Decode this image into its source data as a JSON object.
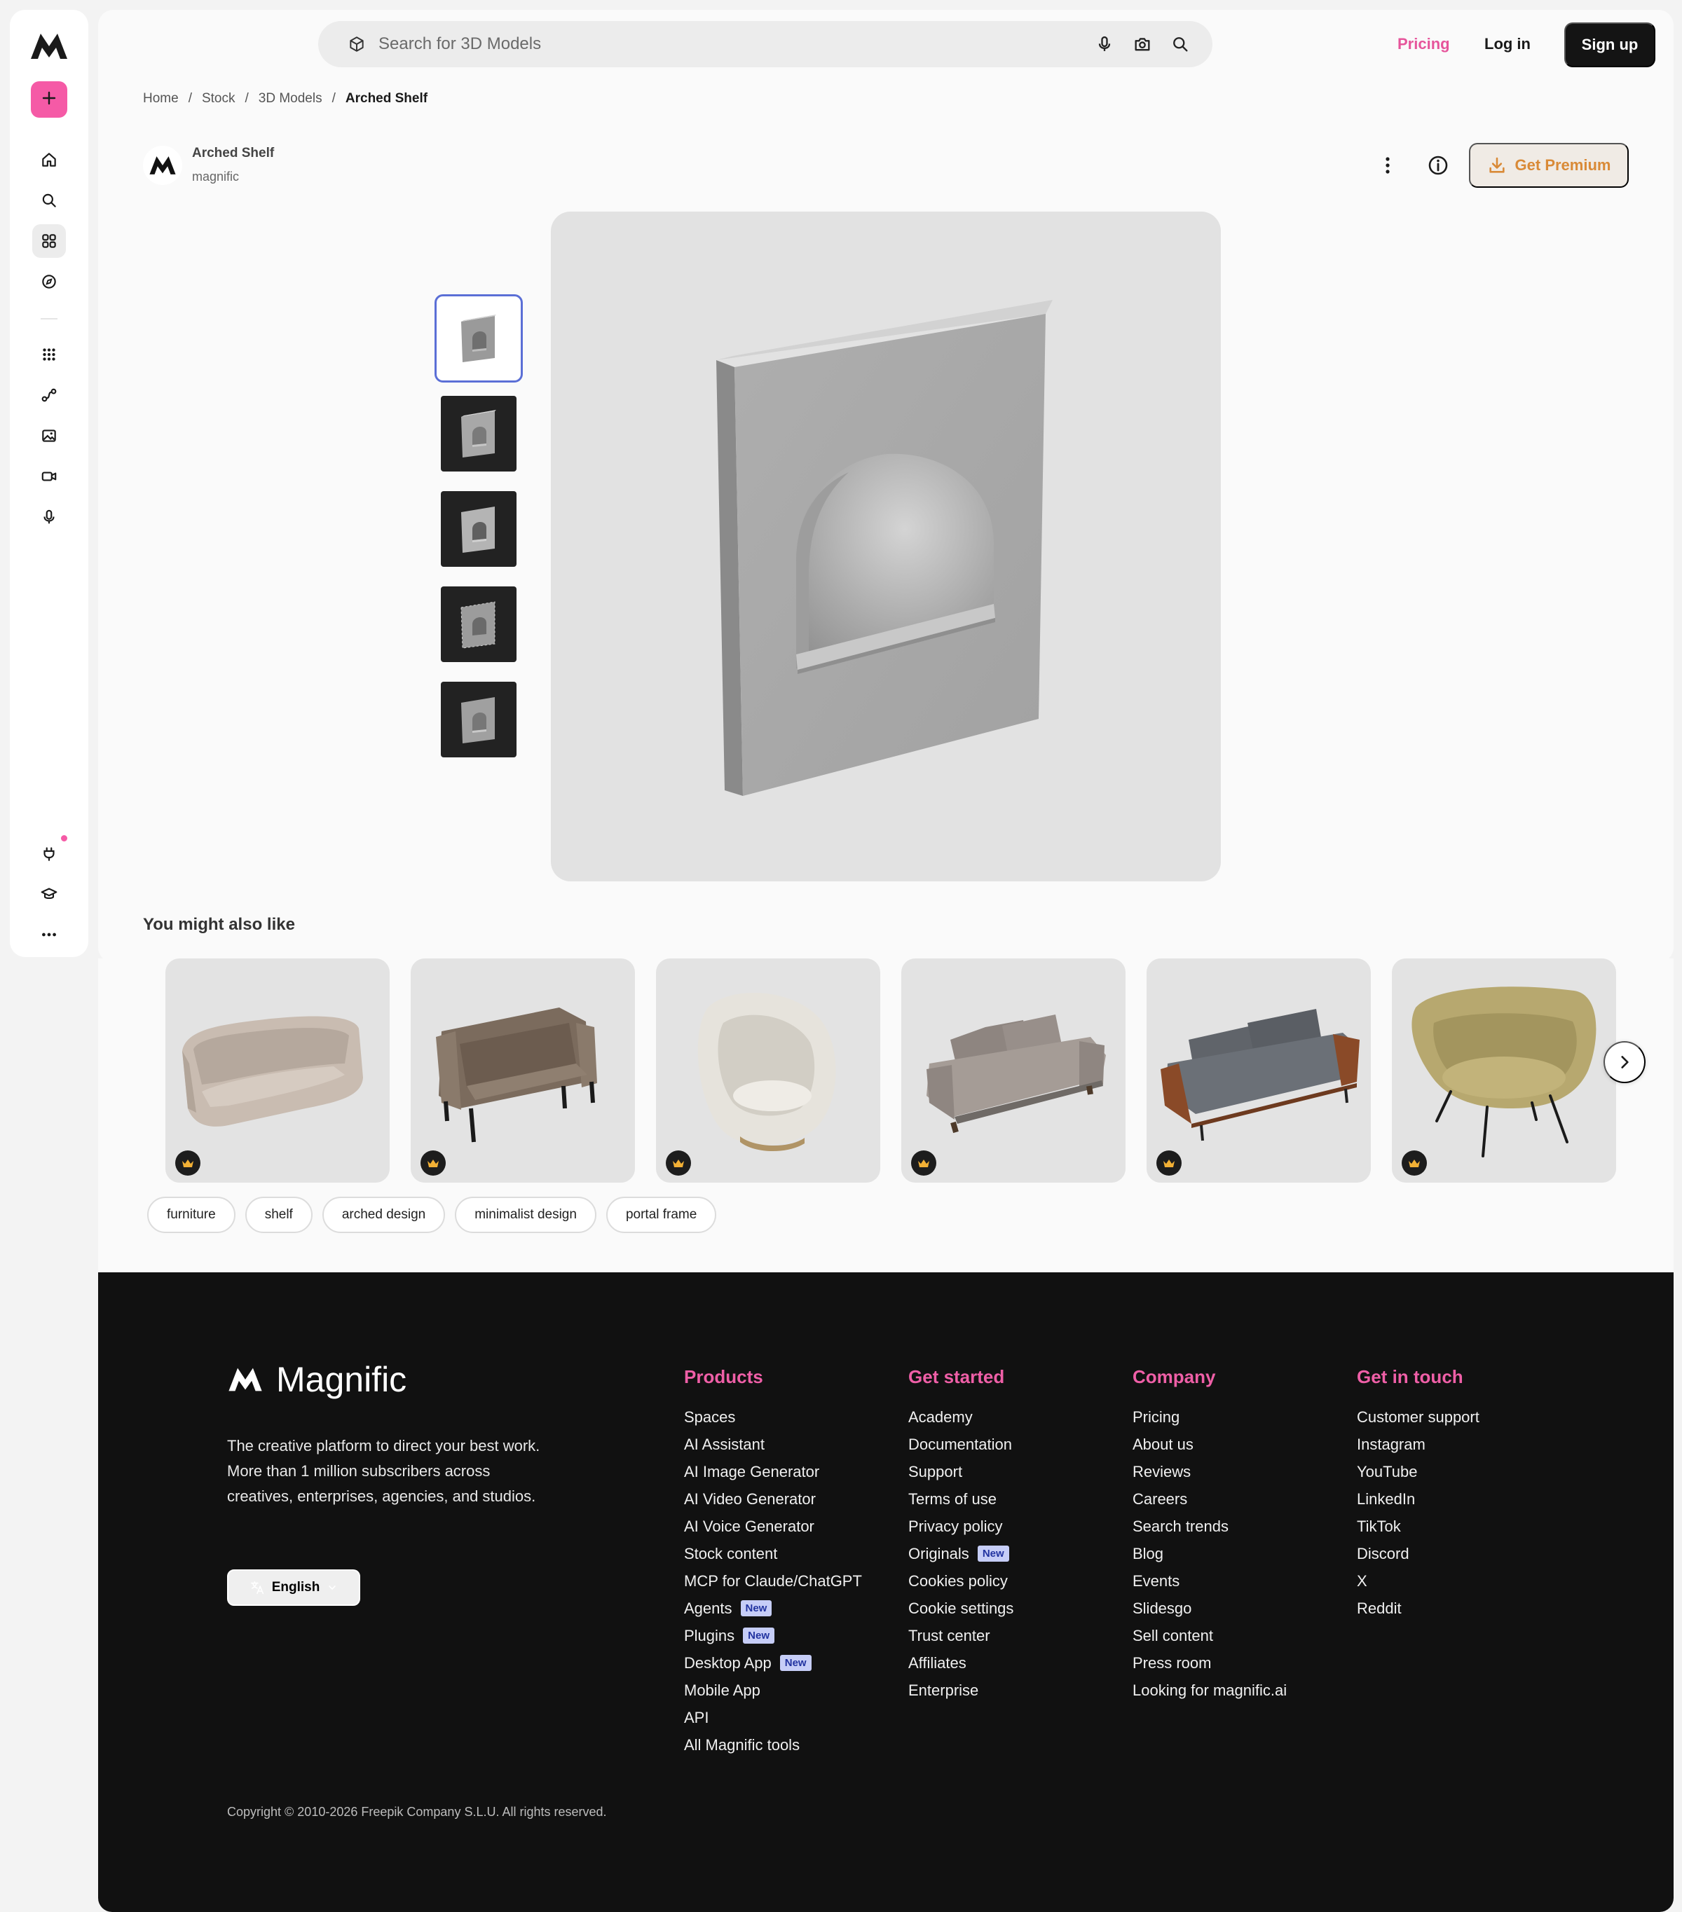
{
  "colors": {
    "accent_pink": "#f55aa6",
    "pricing_pink": "#e6559b",
    "premium_orange": "#d98a37",
    "footer_bg": "#111111",
    "selection_blue": "#5b6fd6",
    "badge_bg": "#c6cdf7"
  },
  "rail": {
    "icons": [
      "logo-icon",
      "plus-icon",
      "home-icon",
      "search-icon",
      "assets-icon",
      "discover-icon",
      "apps-grid-icon",
      "workflow-icon",
      "image-edit-icon",
      "video-icon",
      "microphone-icon",
      "plugin-icon",
      "academy-icon",
      "more-icon"
    ]
  },
  "header": {
    "search_placeholder": "Search for 3D Models",
    "pricing": "Pricing",
    "login": "Log in",
    "signup": "Sign up"
  },
  "breadcrumb": [
    "Home",
    "/",
    "Stock",
    "/",
    "3D Models",
    "/",
    "Arched Shelf"
  ],
  "asset": {
    "title": "Arched Shelf",
    "author": "magnific",
    "premium_label": "Get Premium",
    "thumbnail_count": 5,
    "selected_thumbnail": 1
  },
  "related": {
    "title": "You might also like",
    "items": [
      "beige-curved-sofa",
      "brown-leather-loveseat",
      "white-egg-chair",
      "grey-fabric-sofa",
      "dark-grey-wood-sofa",
      "olive-lounge-chair"
    ],
    "tags": [
      "furniture",
      "shelf",
      "arched design",
      "minimalist design",
      "portal frame"
    ]
  },
  "footer": {
    "brand": "Magnific",
    "description": "The creative platform to direct your best work. More than 1 million subscribers across creatives, enterprises, agencies, and studios.",
    "language": "English",
    "columns": [
      {
        "title": "Products",
        "links": [
          {
            "label": "Spaces"
          },
          {
            "label": "AI Assistant"
          },
          {
            "label": "AI Image Generator"
          },
          {
            "label": "AI Video Generator"
          },
          {
            "label": "AI Voice Generator"
          },
          {
            "label": "Stock content"
          },
          {
            "label": "MCP for Claude/ChatGPT"
          },
          {
            "label": "Agents",
            "badge": "New"
          },
          {
            "label": "Plugins",
            "badge": "New"
          },
          {
            "label": "Desktop App",
            "badge": "New"
          },
          {
            "label": "Mobile App"
          },
          {
            "label": "API"
          },
          {
            "label": "All Magnific tools"
          }
        ]
      },
      {
        "title": "Get started",
        "links": [
          {
            "label": "Academy"
          },
          {
            "label": "Documentation"
          },
          {
            "label": "Support"
          },
          {
            "label": "Terms of use"
          },
          {
            "label": "Privacy policy"
          },
          {
            "label": "Originals",
            "badge": "New"
          },
          {
            "label": "Cookies policy"
          },
          {
            "label": "Cookie settings"
          },
          {
            "label": "Trust center"
          },
          {
            "label": "Affiliates"
          },
          {
            "label": "Enterprise"
          }
        ]
      },
      {
        "title": "Company",
        "links": [
          {
            "label": "Pricing"
          },
          {
            "label": "About us"
          },
          {
            "label": "Reviews"
          },
          {
            "label": "Careers"
          },
          {
            "label": "Search trends"
          },
          {
            "label": "Blog"
          },
          {
            "label": "Events"
          },
          {
            "label": "Slidesgo"
          },
          {
            "label": "Sell content"
          },
          {
            "label": "Press room"
          },
          {
            "label": "Looking for magnific.ai"
          }
        ]
      },
      {
        "title": "Get in touch",
        "links": [
          {
            "label": "Customer support"
          },
          {
            "label": "Instagram"
          },
          {
            "label": "YouTube"
          },
          {
            "label": "LinkedIn"
          },
          {
            "label": "TikTok"
          },
          {
            "label": "Discord"
          },
          {
            "label": "X"
          },
          {
            "label": "Reddit"
          }
        ]
      }
    ],
    "copyright": "Copyright © 2010-2026 Freepik Company S.L.U. All rights reserved."
  }
}
